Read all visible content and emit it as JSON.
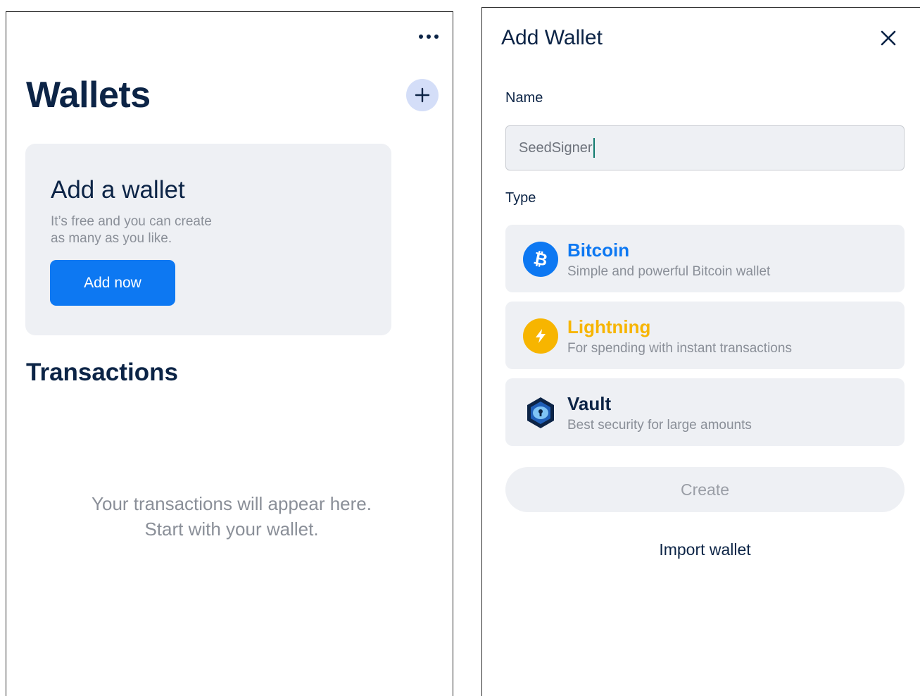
{
  "left_screen": {
    "title": "Wallets",
    "menu_icon": "more-horizontal-icon",
    "add_icon": "plus-icon",
    "add_card": {
      "title": "Add a wallet",
      "subtitle_line1": "It’s free and you can create",
      "subtitle_line2": "as many as you like.",
      "button_label": "Add now"
    },
    "transactions_title": "Transactions",
    "empty_line1": "Your transactions will appear here.",
    "empty_line2": "Start with your wallet."
  },
  "right_screen": {
    "title": "Add Wallet",
    "close_icon": "close-icon",
    "name_label": "Name",
    "name_value": "SeedSigner",
    "type_label": "Type",
    "types": [
      {
        "name": "Bitcoin",
        "description": "Simple and powerful Bitcoin wallet",
        "icon": "bitcoin-icon",
        "color": "#0d78f2"
      },
      {
        "name": "Lightning",
        "description": "For spending with instant transactions",
        "icon": "lightning-icon",
        "color": "#f7b500"
      },
      {
        "name": "Vault",
        "description": "Best security for large amounts",
        "icon": "vault-icon",
        "color": "#0c2446"
      }
    ],
    "create_label": "Create",
    "import_label": "Import wallet"
  },
  "colors": {
    "navy": "#0c2446",
    "primary_blue": "#0d78f2",
    "card_bg": "#eef0f4",
    "muted_text": "#8a8f98",
    "lightning_yellow": "#f7b500"
  }
}
